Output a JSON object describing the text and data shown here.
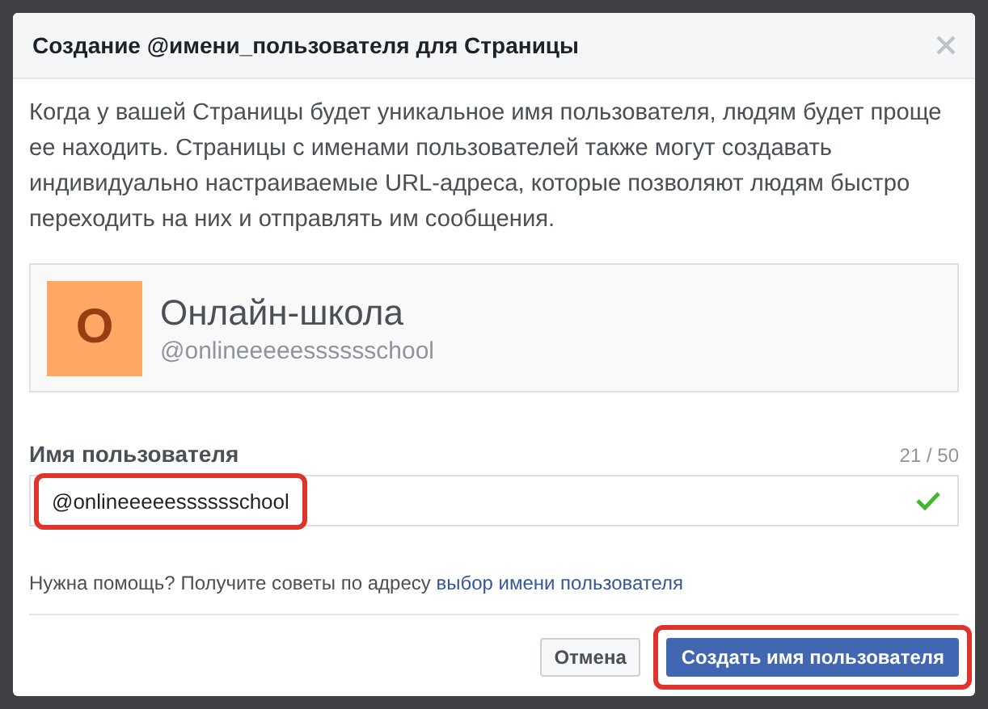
{
  "dialog": {
    "title": "Создание @имени_пользователя для Страницы",
    "description": "Когда у вашей Страницы будет уникальное имя пользователя, людям будет проще ее находить. Страницы с именами пользователей также могут создавать индивидуально настраиваемые URL-адреса, которые позволяют людям быстро переходить на них и отправлять им сообщения.",
    "preview": {
      "avatar_letter": "О",
      "name": "Онлайн-школа",
      "username": "@onlineeeeesssssschool"
    },
    "field": {
      "label": "Имя пользователя",
      "counter": "21 / 50",
      "value": "@onlineeeeesssssschool",
      "valid": true,
      "highlighted": true
    },
    "help": {
      "text": "Нужна помощь? Получите советы по адресу",
      "link": "выбор имени пользователя"
    },
    "buttons": [
      {
        "label": "Отмена",
        "kind": "secondary",
        "highlighted": false
      },
      {
        "label": "Создать имя пользователя",
        "kind": "primary",
        "highlighted": true
      }
    ]
  }
}
